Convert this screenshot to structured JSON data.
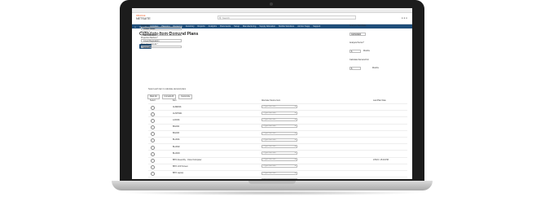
{
  "browser": {
    "search_placeholder": "Search"
  },
  "app": {
    "logo_line1": "ORACLE",
    "logo_line2": "NETSUITE"
  },
  "nav": {
    "items": [
      "Activities",
      "Planning",
      "Receiving",
      "Inventory",
      "Reports",
      "Analytics",
      "Documents",
      "Setup",
      "Manufacturing",
      "Supply Allocation",
      "Mobile Solutions",
      "Ad-hoc Supp",
      "Support"
    ]
  },
  "page": {
    "title": "Calculate Item Demand Plans",
    "submit_label": "Submit"
  },
  "form_left": {
    "fields": [
      {
        "label": "Subsidiary *",
        "value": "United States"
      },
      {
        "label": "Location *",
        "value": "San Francisco"
      },
      {
        "label": "Projection Method *",
        "value": "Linear Regression"
      },
      {
        "label": "Projection Interval *",
        "value": "Monthly"
      }
    ]
  },
  "form_right": {
    "start_label": "Analysis Start Date",
    "start_value": "01/01/2024",
    "period_label": "Analysis Period *",
    "period_value": "6",
    "period_unit": "Months",
    "demand_label": "Calculate Demand For",
    "demand_value": "6",
    "demand_unit": "Months"
  },
  "note": "Select each item to calculate demand plans",
  "table": {
    "buttons": [
      "Mark All",
      "Unmark All",
      "Customize"
    ],
    "headers": {
      "select": "Select",
      "item": "Item",
      "source": "Alternate Source Item",
      "date": "Last Plan Date"
    },
    "select_placeholder": "<Type then tab>",
    "rows": [
      {
        "item": "ALDEN01",
        "date": ""
      },
      {
        "item": "AUSTIN01",
        "date": ""
      },
      {
        "item": "LAC001",
        "date": ""
      },
      {
        "item": "BIG002",
        "date": ""
      },
      {
        "item": "BIG003",
        "date": ""
      },
      {
        "item": "BLU001",
        "date": ""
      },
      {
        "item": "BLU002",
        "date": ""
      },
      {
        "item": "BLU003",
        "date": ""
      },
      {
        "item": "BPO Assembly - Cloud Computer",
        "date": "1/5/16 / 15:04 PM"
      },
      {
        "item": "BPO LCD Screen",
        "date": ""
      },
      {
        "item": "BPO Laptop",
        "date": ""
      },
      {
        "item": "BPO Motherboard",
        "date": ""
      },
      {
        "item": "BPO Mouse",
        "date": ""
      }
    ]
  }
}
